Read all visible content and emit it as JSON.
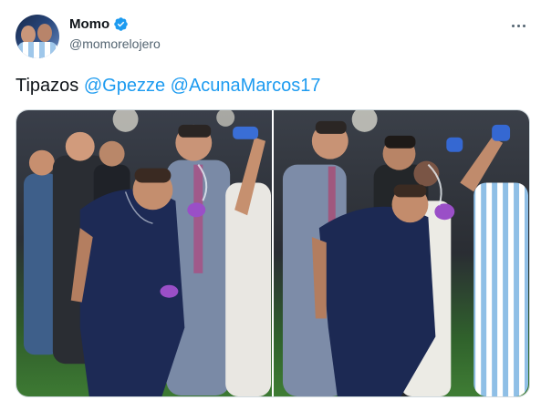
{
  "tweet": {
    "author": {
      "name": "Momo",
      "handle": "@momorelojero",
      "verified": true
    },
    "text": {
      "prefix": "Tipazos ",
      "mention1": "@Gpezze",
      "separator": " ",
      "mention2": "@AcunaMarcos17"
    },
    "media_count": 2,
    "colors": {
      "mention": "#1d9bf0",
      "verified_badge": "#1d9bf0",
      "handle": "#536471",
      "border": "#cfd9de"
    },
    "icons": [
      "verified-badge-icon",
      "more-options-icon"
    ]
  }
}
